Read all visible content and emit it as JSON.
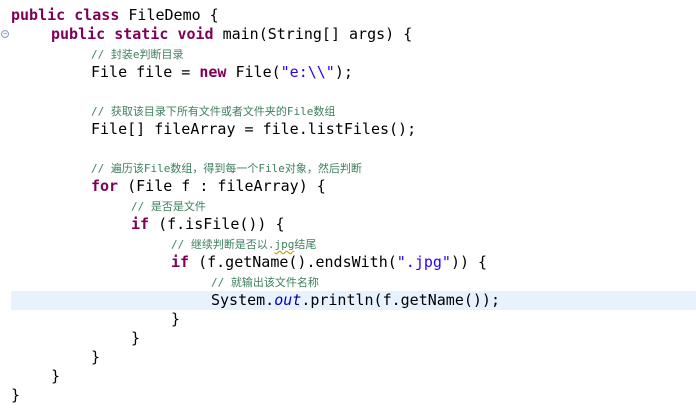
{
  "editor": {
    "lines": [
      {
        "indent": 0,
        "tokens": [
          {
            "t": "kw",
            "v": "public"
          },
          {
            "t": "plain",
            "v": " "
          },
          {
            "t": "kw",
            "v": "class"
          },
          {
            "t": "plain",
            "v": " FileDemo {"
          }
        ]
      },
      {
        "indent": 1,
        "tokens": [
          {
            "t": "kw",
            "v": "public"
          },
          {
            "t": "plain",
            "v": " "
          },
          {
            "t": "kw",
            "v": "static"
          },
          {
            "t": "plain",
            "v": " "
          },
          {
            "t": "kw",
            "v": "void"
          },
          {
            "t": "plain",
            "v": " main(String[] args) {"
          }
        ]
      },
      {
        "indent": 2,
        "tokens": [
          {
            "t": "cm",
            "v": "// 封装e判断目录"
          }
        ]
      },
      {
        "indent": 2,
        "tokens": [
          {
            "t": "plain",
            "v": "File file = "
          },
          {
            "t": "kw",
            "v": "new"
          },
          {
            "t": "plain",
            "v": " File("
          },
          {
            "t": "str",
            "v": "\"e:\\\\\""
          },
          {
            "t": "plain",
            "v": ");"
          }
        ]
      },
      {
        "indent": 0,
        "tokens": []
      },
      {
        "indent": 2,
        "tokens": [
          {
            "t": "cm",
            "v": "// 获取该目录下所有文件或者文件夹的File数组"
          }
        ]
      },
      {
        "indent": 2,
        "tokens": [
          {
            "t": "plain",
            "v": "File[] fileArray = file.listFiles();"
          }
        ]
      },
      {
        "indent": 0,
        "tokens": []
      },
      {
        "indent": 2,
        "tokens": [
          {
            "t": "cm",
            "v": "// 遍历该File数组，得到每一个File对象，然后判断"
          }
        ]
      },
      {
        "indent": 2,
        "tokens": [
          {
            "t": "kw",
            "v": "for"
          },
          {
            "t": "plain",
            "v": " (File f : fileArray) {"
          }
        ]
      },
      {
        "indent": 3,
        "tokens": [
          {
            "t": "cm",
            "v": "// 是否是文件"
          }
        ]
      },
      {
        "indent": 3,
        "tokens": [
          {
            "t": "kw",
            "v": "if"
          },
          {
            "t": "plain",
            "v": " (f.isFile()) {"
          }
        ]
      },
      {
        "indent": 4,
        "tokens": [
          {
            "t": "cm",
            "v": "// 继续判断是否以."
          },
          {
            "t": "cm-squiggle",
            "v": "jpg"
          },
          {
            "t": "cm",
            "v": "结尾"
          }
        ]
      },
      {
        "indent": 4,
        "tokens": [
          {
            "t": "kw",
            "v": "if"
          },
          {
            "t": "plain",
            "v": " (f.getName().endsWith("
          },
          {
            "t": "str",
            "v": "\".jpg\""
          },
          {
            "t": "plain",
            "v": ")) {"
          }
        ]
      },
      {
        "indent": 5,
        "tokens": [
          {
            "t": "cm",
            "v": "// 就输出该文件名称"
          }
        ]
      },
      {
        "indent": 5,
        "highlight": true,
        "tokens": [
          {
            "t": "plain",
            "v": "System."
          },
          {
            "t": "fld",
            "v": "out"
          },
          {
            "t": "plain",
            "v": ".println(f.getName());"
          }
        ]
      },
      {
        "indent": 4,
        "tokens": [
          {
            "t": "plain",
            "v": "}"
          }
        ]
      },
      {
        "indent": 3,
        "tokens": [
          {
            "t": "plain",
            "v": "}"
          }
        ]
      },
      {
        "indent": 2,
        "tokens": [
          {
            "t": "plain",
            "v": "}"
          }
        ]
      },
      {
        "indent": 1,
        "tokens": [
          {
            "t": "plain",
            "v": "}"
          }
        ]
      },
      {
        "indent": 0,
        "tokens": [
          {
            "t": "plain",
            "v": "}"
          }
        ]
      }
    ]
  }
}
